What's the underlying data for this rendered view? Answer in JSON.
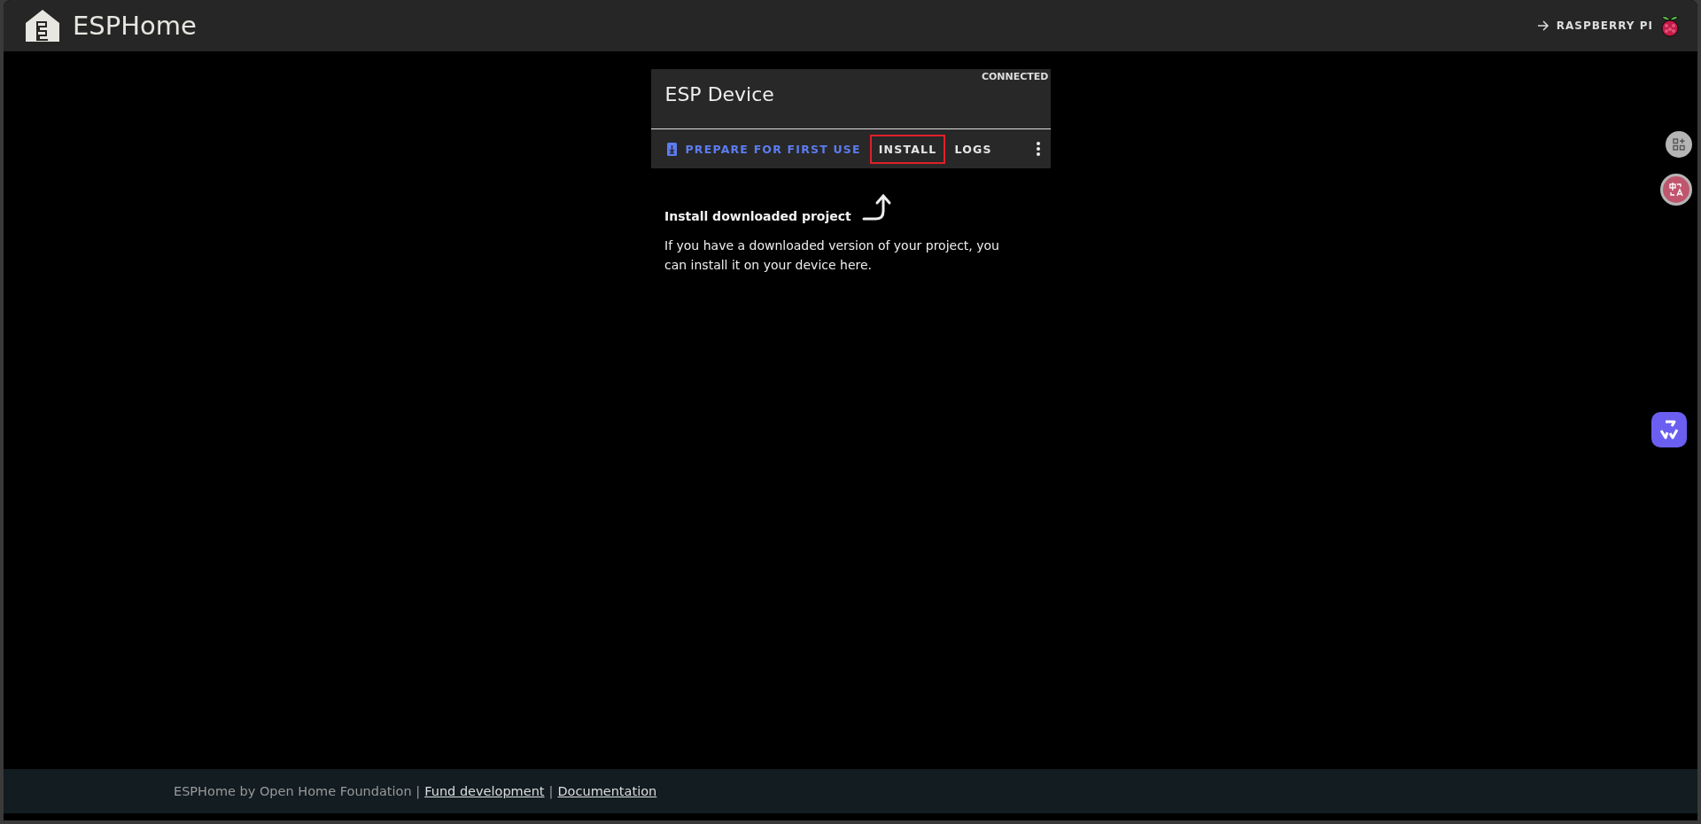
{
  "header": {
    "title": "ESPHome",
    "link": {
      "label": "RASPBERRY PI"
    }
  },
  "card": {
    "title": "ESP Device",
    "status": "CONNECTED",
    "actions": [
      {
        "label": "PREPARE FOR FIRST USE",
        "primary": true,
        "highlighted": false
      },
      {
        "label": "INSTALL",
        "primary": false,
        "highlighted": true
      },
      {
        "label": "LOGS",
        "primary": false,
        "highlighted": false
      }
    ]
  },
  "hint": {
    "title": "Install downloaded project",
    "text": "If you have a downloaded version of your project, you can install it on your device here."
  },
  "footer": {
    "credit": "ESPHome by Open Home Foundation |",
    "separator": "|",
    "links": [
      "Fund development",
      "Documentation"
    ]
  }
}
